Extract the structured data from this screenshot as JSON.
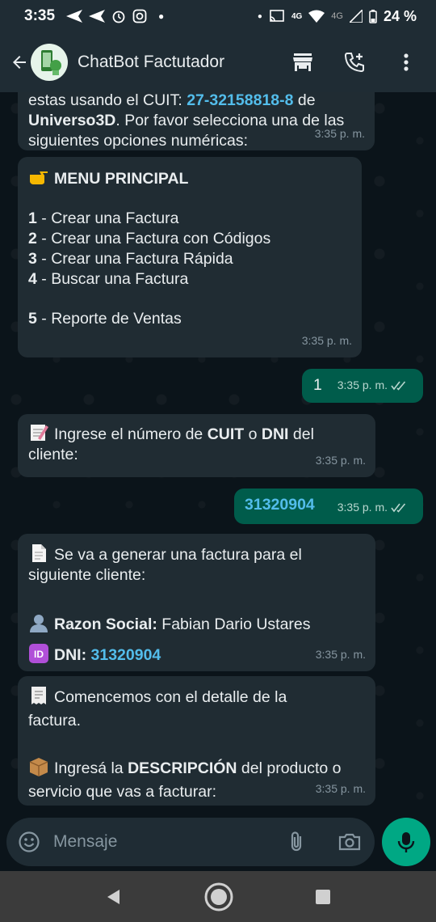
{
  "status_bar": {
    "time": "3:35",
    "network_label_1": "4G",
    "network_label_2": "4G",
    "battery": "24 %"
  },
  "header": {
    "title": "ChatBot Factutador",
    "icons": [
      "back-arrow-icon",
      "store-icon",
      "add-call-icon",
      "more-vert-icon"
    ]
  },
  "messages": {
    "m1": {
      "line1_pre": "estas usando el CUIT: ",
      "line1_cuit": "27-32158818-8",
      "line1_post": " de",
      "line2_bold": "Universo3D",
      "line2_rest": ". Por favor selecciona una de las",
      "line3": "siguientes opciones numéricas:",
      "time": "3:35 p. m."
    },
    "m2": {
      "title": "MENU PRINCIPAL",
      "items": [
        {
          "num": "1",
          "text": " - Crear una Factura"
        },
        {
          "num": "2",
          "text": " - Crear una Factura con Códigos"
        },
        {
          "num": "3",
          "text": " - Crear una Factura Rápida"
        },
        {
          "num": "4",
          "text": " - Buscar una Factura"
        },
        {
          "num": "5",
          "text": " - Reporte de Ventas"
        }
      ],
      "time": "3:35 p. m."
    },
    "m3": {
      "text": "1",
      "time": "3:35 p. m."
    },
    "m4": {
      "pre": "Ingrese el número de ",
      "cuit": "CUIT",
      "mid": " o ",
      "dni": "DNI",
      "post": " del",
      "line2": "cliente:",
      "time": "3:35 p. m."
    },
    "m5": {
      "text": "31320904",
      "time": "3:35 p. m."
    },
    "m6": {
      "line1": "Se va a generar una factura para el",
      "line2": "siguiente cliente:",
      "razon_label": "Razon Social:",
      "razon_value": " Fabian Dario Ustares",
      "dni_label": "DNI:",
      "dni_value": "31320904",
      "time": "3:35 p. m."
    },
    "m7": {
      "line1": "Comencemos con el detalle de la",
      "line2": "factura.",
      "pre": "Ingresá la ",
      "bold": "DESCRIPCIÓN",
      "post": " del producto o",
      "line4": "servicio que vas a facturar:",
      "time": "3:35 p. m."
    }
  },
  "composer": {
    "placeholder": "Mensaje"
  },
  "colors": {
    "background": "#0b141a",
    "incoming_bubble": "#202c33",
    "outgoing_bubble": "#005c4b",
    "accent": "#00a884",
    "link": "#53bdeb"
  }
}
